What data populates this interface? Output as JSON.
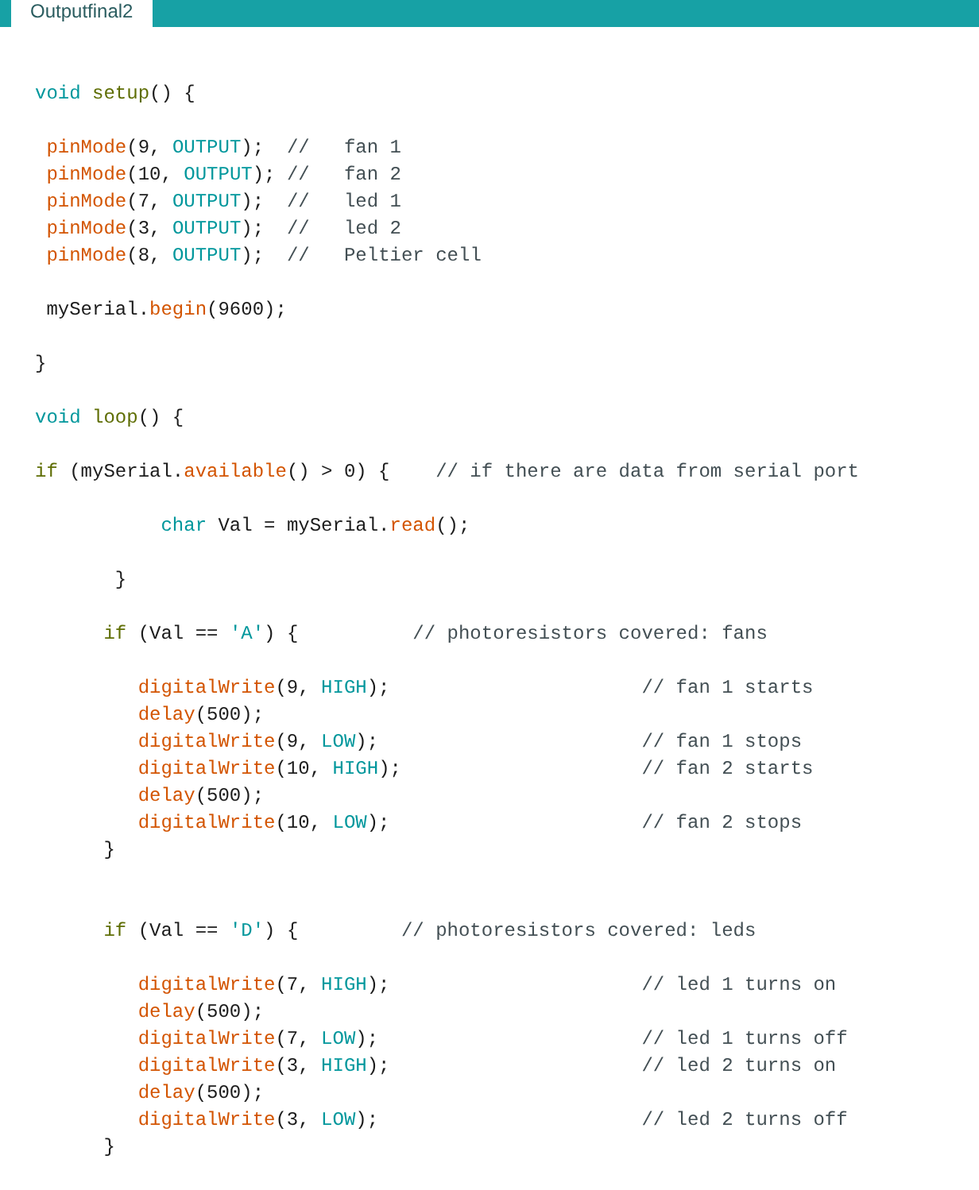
{
  "tabs": [
    {
      "label": "Outputfinal2",
      "selected": true
    }
  ],
  "editor": {
    "lines": [
      {
        "kind": "code",
        "tokens": [
          {
            "text": "void",
            "kind": "type"
          },
          {
            "text": " setup",
            "kind": "structure"
          },
          {
            "text": "() {",
            "kind": "plain"
          }
        ]
      },
      {
        "kind": "blank"
      },
      {
        "kind": "code",
        "tokens": [
          {
            "text": " pinMode",
            "kind": "method"
          },
          {
            "text": "(9, ",
            "kind": "plain"
          },
          {
            "text": "OUTPUT",
            "kind": "constant"
          },
          {
            "text": ");",
            "kind": "plain"
          }
        ],
        "comment": "  //   fan 1"
      },
      {
        "kind": "code",
        "tokens": [
          {
            "text": " pinMode",
            "kind": "method"
          },
          {
            "text": "(10, ",
            "kind": "plain"
          },
          {
            "text": "OUTPUT",
            "kind": "constant"
          },
          {
            "text": ");",
            "kind": "plain"
          }
        ],
        "comment": " //   fan 2"
      },
      {
        "kind": "code",
        "tokens": [
          {
            "text": " pinMode",
            "kind": "method"
          },
          {
            "text": "(7, ",
            "kind": "plain"
          },
          {
            "text": "OUTPUT",
            "kind": "constant"
          },
          {
            "text": ");",
            "kind": "plain"
          }
        ],
        "comment": "  //   led 1"
      },
      {
        "kind": "code",
        "tokens": [
          {
            "text": " pinMode",
            "kind": "method"
          },
          {
            "text": "(3, ",
            "kind": "plain"
          },
          {
            "text": "OUTPUT",
            "kind": "constant"
          },
          {
            "text": ");",
            "kind": "plain"
          }
        ],
        "comment": "  //   led 2"
      },
      {
        "kind": "code",
        "tokens": [
          {
            "text": " pinMode",
            "kind": "method"
          },
          {
            "text": "(8, ",
            "kind": "plain"
          },
          {
            "text": "OUTPUT",
            "kind": "constant"
          },
          {
            "text": ");",
            "kind": "plain"
          }
        ],
        "comment": "  //   Peltier cell"
      },
      {
        "kind": "blank"
      },
      {
        "kind": "code",
        "tokens": [
          {
            "text": " mySerial.",
            "kind": "plain"
          },
          {
            "text": "begin",
            "kind": "method"
          },
          {
            "text": "(9600);",
            "kind": "plain"
          }
        ]
      },
      {
        "kind": "blank"
      },
      {
        "kind": "code",
        "tokens": [
          {
            "text": "}",
            "kind": "plain"
          }
        ]
      },
      {
        "kind": "blank"
      },
      {
        "kind": "code",
        "tokens": [
          {
            "text": "void",
            "kind": "type"
          },
          {
            "text": " loop",
            "kind": "structure"
          },
          {
            "text": "() {",
            "kind": "plain"
          }
        ]
      },
      {
        "kind": "blank"
      },
      {
        "kind": "code",
        "tokens": [
          {
            "text": "if",
            "kind": "structure"
          },
          {
            "text": " (mySerial.",
            "kind": "plain"
          },
          {
            "text": "available",
            "kind": "method"
          },
          {
            "text": "() > 0) {",
            "kind": "plain"
          }
        ],
        "comment": "    // if there are data from serial port"
      },
      {
        "kind": "blank"
      },
      {
        "kind": "code",
        "tokens": [
          {
            "text": "           char",
            "kind": "type"
          },
          {
            "text": " Val = mySerial.",
            "kind": "plain"
          },
          {
            "text": "read",
            "kind": "method"
          },
          {
            "text": "();",
            "kind": "plain"
          }
        ]
      },
      {
        "kind": "blank"
      },
      {
        "kind": "code",
        "tokens": [
          {
            "text": "       }",
            "kind": "plain"
          }
        ]
      },
      {
        "kind": "blank"
      },
      {
        "kind": "code",
        "tokens": [
          {
            "text": "      if",
            "kind": "structure"
          },
          {
            "text": " (Val == ",
            "kind": "plain"
          },
          {
            "text": "'A'",
            "kind": "string"
          },
          {
            "text": ") {",
            "kind": "plain"
          }
        ],
        "comment": "          // photoresistors covered: fans"
      },
      {
        "kind": "blank"
      },
      {
        "kind": "code",
        "tokens": [
          {
            "text": "         digitalWrite",
            "kind": "method"
          },
          {
            "text": "(9, ",
            "kind": "plain"
          },
          {
            "text": "HIGH",
            "kind": "constant"
          },
          {
            "text": ");",
            "kind": "plain"
          }
        ],
        "comment": "                      // fan 1 starts"
      },
      {
        "kind": "code",
        "tokens": [
          {
            "text": "         delay",
            "kind": "method"
          },
          {
            "text": "(500);",
            "kind": "plain"
          }
        ]
      },
      {
        "kind": "code",
        "tokens": [
          {
            "text": "         digitalWrite",
            "kind": "method"
          },
          {
            "text": "(9, ",
            "kind": "plain"
          },
          {
            "text": "LOW",
            "kind": "constant"
          },
          {
            "text": ");",
            "kind": "plain"
          }
        ],
        "comment": "                       // fan 1 stops"
      },
      {
        "kind": "code",
        "tokens": [
          {
            "text": "         digitalWrite",
            "kind": "method"
          },
          {
            "text": "(10, ",
            "kind": "plain"
          },
          {
            "text": "HIGH",
            "kind": "constant"
          },
          {
            "text": ");",
            "kind": "plain"
          }
        ],
        "comment": "                     // fan 2 starts"
      },
      {
        "kind": "code",
        "tokens": [
          {
            "text": "         delay",
            "kind": "method"
          },
          {
            "text": "(500);",
            "kind": "plain"
          }
        ]
      },
      {
        "kind": "code",
        "tokens": [
          {
            "text": "         digitalWrite",
            "kind": "method"
          },
          {
            "text": "(10, ",
            "kind": "plain"
          },
          {
            "text": "LOW",
            "kind": "constant"
          },
          {
            "text": ");",
            "kind": "plain"
          }
        ],
        "comment": "                      // fan 2 stops"
      },
      {
        "kind": "code",
        "tokens": [
          {
            "text": "      }",
            "kind": "plain"
          }
        ]
      },
      {
        "kind": "blank"
      },
      {
        "kind": "blank"
      },
      {
        "kind": "code",
        "tokens": [
          {
            "text": "      if",
            "kind": "structure"
          },
          {
            "text": " (Val == ",
            "kind": "plain"
          },
          {
            "text": "'D'",
            "kind": "string"
          },
          {
            "text": ") {",
            "kind": "plain"
          }
        ],
        "comment": "         // photoresistors covered: leds"
      },
      {
        "kind": "blank"
      },
      {
        "kind": "code",
        "tokens": [
          {
            "text": "         digitalWrite",
            "kind": "method"
          },
          {
            "text": "(7, ",
            "kind": "plain"
          },
          {
            "text": "HIGH",
            "kind": "constant"
          },
          {
            "text": ");",
            "kind": "plain"
          }
        ],
        "comment": "                      // led 1 turns on"
      },
      {
        "kind": "code",
        "tokens": [
          {
            "text": "         delay",
            "kind": "method"
          },
          {
            "text": "(500);",
            "kind": "plain"
          }
        ]
      },
      {
        "kind": "code",
        "tokens": [
          {
            "text": "         digitalWrite",
            "kind": "method"
          },
          {
            "text": "(7, ",
            "kind": "plain"
          },
          {
            "text": "LOW",
            "kind": "constant"
          },
          {
            "text": ");",
            "kind": "plain"
          }
        ],
        "comment": "                       // led 1 turns off"
      },
      {
        "kind": "code",
        "tokens": [
          {
            "text": "         digitalWrite",
            "kind": "method"
          },
          {
            "text": "(3, ",
            "kind": "plain"
          },
          {
            "text": "HIGH",
            "kind": "constant"
          },
          {
            "text": ");",
            "kind": "plain"
          }
        ],
        "comment": "                      // led 2 turns on"
      },
      {
        "kind": "code",
        "tokens": [
          {
            "text": "         delay",
            "kind": "method"
          },
          {
            "text": "(500);",
            "kind": "plain"
          }
        ]
      },
      {
        "kind": "code",
        "tokens": [
          {
            "text": "         digitalWrite",
            "kind": "method"
          },
          {
            "text": "(3, ",
            "kind": "plain"
          },
          {
            "text": "LOW",
            "kind": "constant"
          },
          {
            "text": ");",
            "kind": "plain"
          }
        ],
        "comment": "                       // led 2 turns off"
      },
      {
        "kind": "code",
        "tokens": [
          {
            "text": "      }",
            "kind": "plain"
          }
        ]
      }
    ]
  }
}
